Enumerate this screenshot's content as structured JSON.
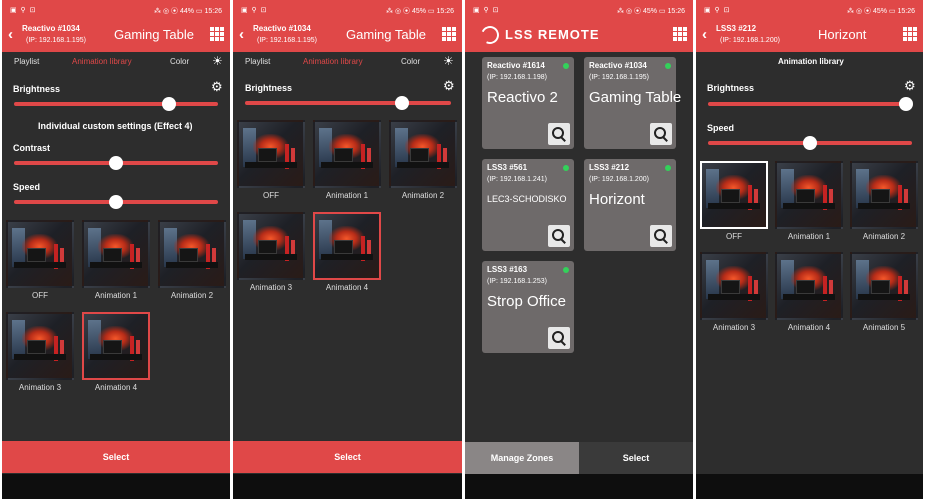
{
  "statusbar": {
    "icons_left": "▣ ⚲ ⊡",
    "screen1": "⁂ ◎ ⦿ 44% ▭ 15:26",
    "screen2": "⁂ ◎ ⦿ 45% ▭ 15:26",
    "screen3": "⁂ ◎ ⦿ 45% ▭ 15:26",
    "screen4": "⁂ ◎ ⦿ 45% ▭ 15:26"
  },
  "icons": {
    "back": "‹",
    "sun": "☀",
    "gear": "⚙"
  },
  "screen1": {
    "device_name": "Reactivo #1034",
    "device_ip": "(IP: 192.168.1.195)",
    "title": "Gaming Table",
    "tabs": [
      "Playlist",
      "Animation library",
      "Color"
    ],
    "brightness_label": "Brightness",
    "brightness_value": 0.76,
    "section_title": "Individual custom settings (Effect 4)",
    "contrast_label": "Contrast",
    "contrast_value": 0.5,
    "speed_label": "Speed",
    "speed_value": 0.5,
    "tiles": [
      "OFF",
      "Animation 1",
      "Animation 2",
      "Animation 3",
      "Animation 4"
    ],
    "select_label": "Select"
  },
  "screen2": {
    "device_name": "Reactivo #1034",
    "device_ip": "(IP: 192.168.1.195)",
    "title": "Gaming Table",
    "tabs": [
      "Playlist",
      "Animation library",
      "Color"
    ],
    "brightness_label": "Brightness",
    "brightness_value": 0.76,
    "tiles": [
      "OFF",
      "Animation 1",
      "Animation 2",
      "Animation 3",
      "Animation 4"
    ],
    "select_label": "Select"
  },
  "screen3": {
    "logo": "LSS REMOTE",
    "cards": [
      {
        "name": "Reactivo #1614",
        "ip": "(IP: 192.168.1.198)",
        "label": "Reactivo 2"
      },
      {
        "name": "Reactivo #1034",
        "ip": "(IP: 192.168.1.195)",
        "label": "Gaming Table"
      },
      {
        "name": "LSS3 #561",
        "ip": "(IP: 192.168.1.241)",
        "label": "LEC3-SCHODISKO"
      },
      {
        "name": "LSS3 #212",
        "ip": "(IP: 192.168.1.200)",
        "label": "Horizont"
      },
      {
        "name": "LSS3 #163",
        "ip": "(IP: 192.168.1.253)",
        "label": "Strop Office"
      }
    ],
    "manage_label": "Manage Zones",
    "select_label": "Select"
  },
  "screen4": {
    "device_name": "LSS3 #212",
    "device_ip": "(IP: 192.168.1.200)",
    "title": "Horizont",
    "tab": "Animation library",
    "brightness_label": "Brightness",
    "brightness_value": 0.97,
    "speed_label": "Speed",
    "speed_value": 0.5,
    "tiles": [
      "OFF",
      "Animation 1",
      "Animation 2",
      "Animation 3",
      "Animation 4",
      "Animation 5"
    ]
  },
  "colors": {
    "accent": "#e04848",
    "background": "#2d2d2d",
    "card": "#6e6a6a",
    "online": "#33d15a"
  }
}
